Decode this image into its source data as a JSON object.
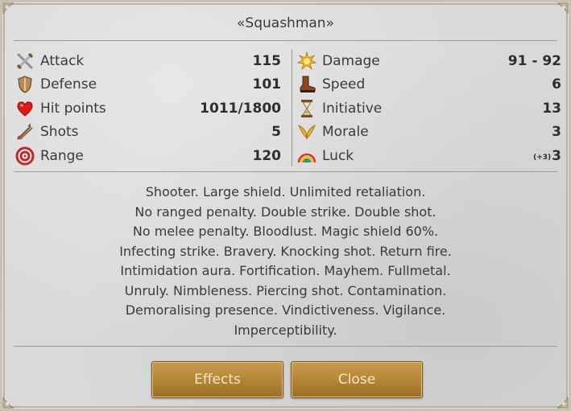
{
  "dialog": {
    "title": "«Squashman»"
  },
  "stats_left": [
    {
      "label": "Attack",
      "value": "115",
      "icon": "crossed-swords-icon"
    },
    {
      "label": "Defense",
      "value": "101",
      "icon": "shield-icon"
    },
    {
      "label": "Hit points",
      "value": "1011/1800",
      "icon": "heart-icon"
    },
    {
      "label": "Shots",
      "value": "5",
      "icon": "arrows-icon"
    },
    {
      "label": "Range",
      "value": "120",
      "icon": "target-icon"
    }
  ],
  "stats_right": [
    {
      "label": "Damage",
      "value": "91 - 92",
      "icon": "burst-icon"
    },
    {
      "label": "Speed",
      "value": "6",
      "icon": "boot-icon"
    },
    {
      "label": "Initiative",
      "value": "13",
      "icon": "hourglass-icon"
    },
    {
      "label": "Morale",
      "value": "3",
      "icon": "wings-icon"
    },
    {
      "label": "Luck",
      "value": "3",
      "bonus": "(+3)",
      "icon": "rainbow-icon"
    }
  ],
  "abilities": [
    "Shooter. Large shield. Unlimited retaliation.",
    "No ranged penalty. Double strike. Double shot.",
    "No melee penalty. Bloodlust. Magic shield 60%.",
    "Infecting strike. Bravery. Knocking shot. Return fire.",
    "Intimidation aura. Fortification. Mayhem. Fullmetal.",
    "Unruly. Nimbleness. Piercing shot. Contamination.",
    "Demoralising presence. Vindictiveness. Vigilance.",
    "Imperceptibility."
  ],
  "buttons": {
    "effects_label": "Effects",
    "close_label": "Close"
  },
  "colors": {
    "button_gold": "#b7883a",
    "button_text": "#f4e6c4",
    "panel_bg": "#d9d9d9"
  }
}
